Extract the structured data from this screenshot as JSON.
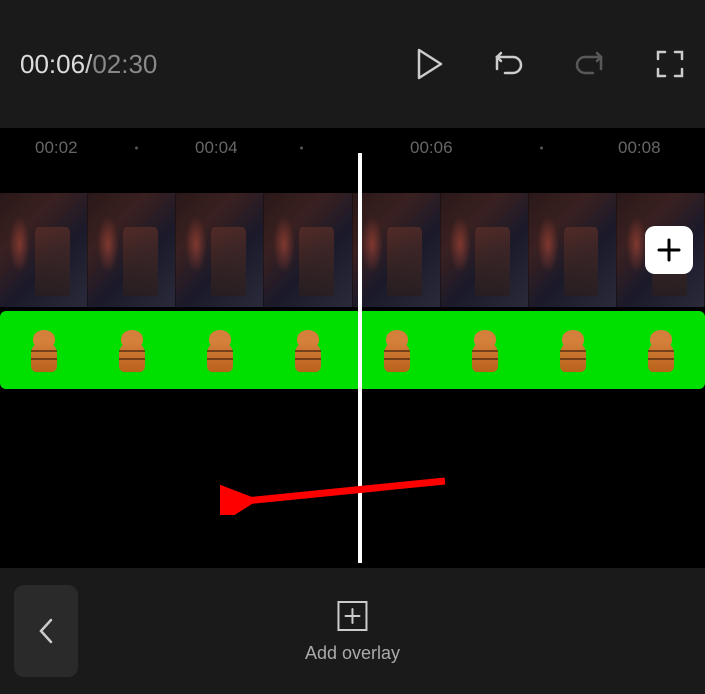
{
  "playback": {
    "current_time": "00:06",
    "total_time": "02:30",
    "separator": "/"
  },
  "ruler": {
    "marks": [
      "00:02",
      "00:04",
      "00:06",
      "00:08"
    ]
  },
  "bottom": {
    "add_overlay_label": "Add overlay"
  },
  "colors": {
    "overlay_track": "#00e000",
    "arrow": "#ff0000",
    "playhead": "#ffffff"
  }
}
